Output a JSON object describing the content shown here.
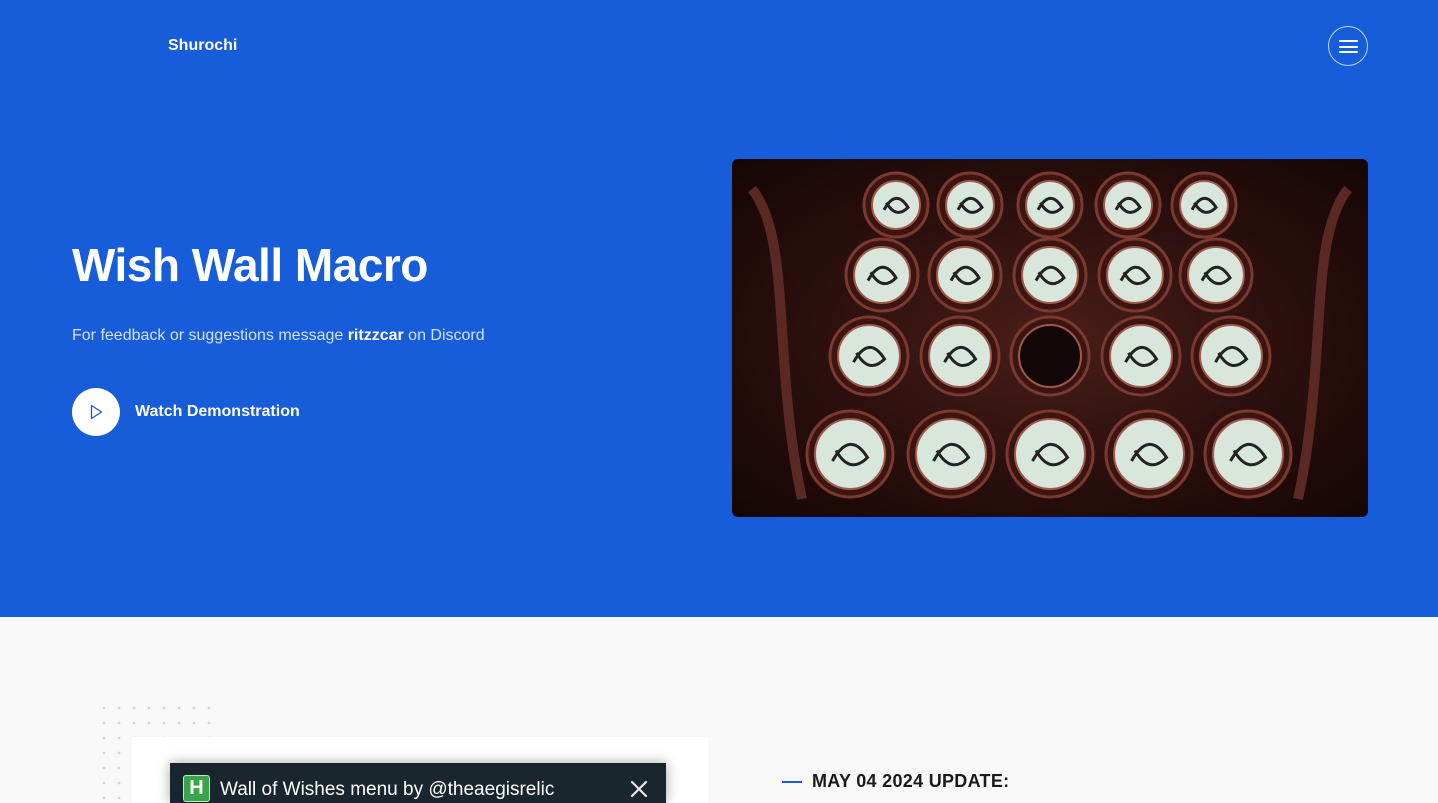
{
  "header": {
    "brand": "Shurochi",
    "menu_icon": "hamburger-menu-icon"
  },
  "hero": {
    "title": "Wish Wall Macro",
    "subtitle_prefix": "For feedback or suggestions message ",
    "subtitle_user": "ritzzcar",
    "subtitle_suffix": " on Discord",
    "watch_label": "Watch Demonstration",
    "play_icon": "play-icon"
  },
  "screenshot_window": {
    "app_badge": "H",
    "title": "Wall of Wishes menu by @theaegisrelic",
    "close_icon": "close-icon"
  },
  "section": {
    "update_heading": "MAY 04 2024 UPDATE:"
  },
  "colors": {
    "hero_background": "#175cd8",
    "page_background": "#f8f8f8",
    "accent": "#175cd8"
  }
}
